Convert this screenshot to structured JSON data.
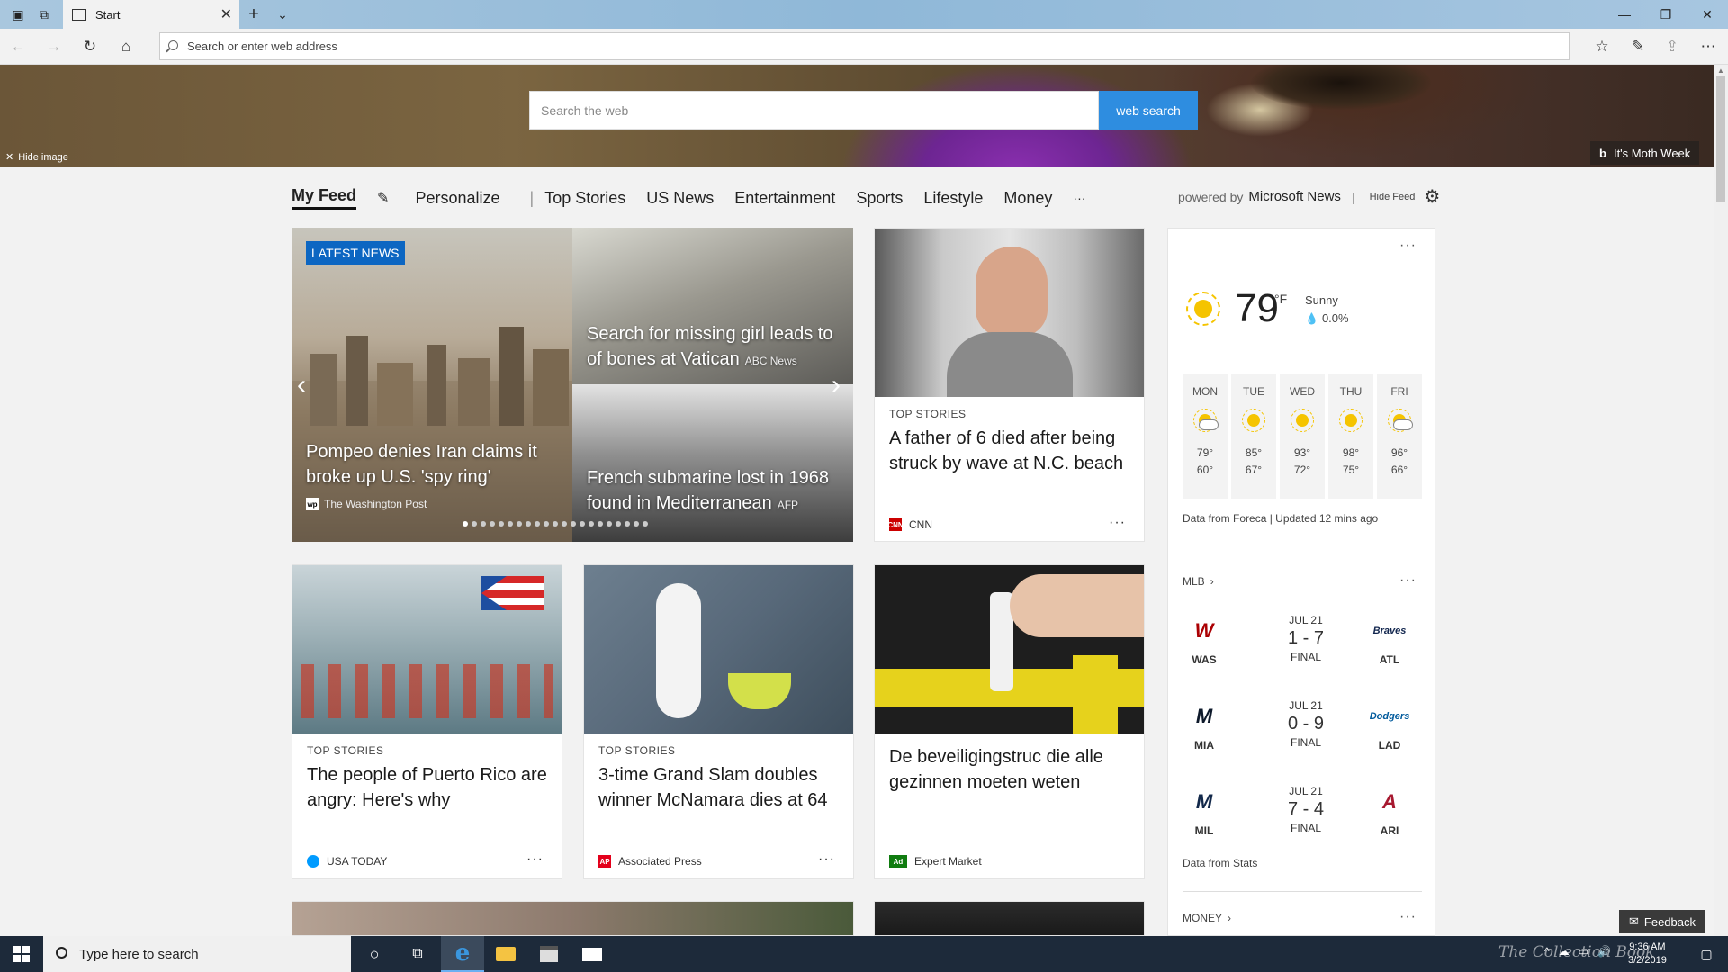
{
  "browser": {
    "tab_title": "Start",
    "address_placeholder": "Search or enter web address"
  },
  "hero": {
    "search_placeholder": "Search the web",
    "search_button": "web search",
    "hide_image": "Hide image",
    "image_caption": "It's Moth Week"
  },
  "feed_nav": {
    "items": [
      "My Feed",
      "Personalize",
      "Top Stories",
      "US News",
      "Entertainment",
      "Sports",
      "Lifestyle",
      "Money",
      "···"
    ],
    "powered_prefix": "powered by",
    "powered_brand": "Microsoft News",
    "hide_feed": "Hide Feed"
  },
  "carousel": {
    "badge": "LATEST NEWS",
    "main_title": "Pompeo denies Iran claims it broke up U.S. 'spy ring'",
    "main_source": "The Washington Post",
    "top_right_title": "Search for missing girl leads to of bones at Vatican",
    "top_right_source": "ABC News",
    "bottom_right_title": "French submarine lost in 1968 found in Mediterranean",
    "bottom_right_source": "AFP",
    "dot_count": 21,
    "active_dot": 0
  },
  "cards": [
    {
      "category": "TOP STORIES",
      "title": "A father of 6 died after being struck by wave at N.C. beach",
      "source": "CNN",
      "logo_text": "CNN",
      "logo_color": "#cc0000"
    },
    {
      "category": "TOP STORIES",
      "title": "The people of Puerto Rico are angry: Here's why",
      "source": "USA TODAY",
      "logo_text": "",
      "logo_color": "#009bff"
    },
    {
      "category": "TOP STORIES",
      "title": "3-time Grand Slam doubles winner McNamara dies at 64",
      "source": "Associated Press",
      "logo_text": "AP",
      "logo_color": "#e3001b"
    },
    {
      "category": "",
      "title": "De beveiligingstruc die alle gezinnen moeten weten",
      "source": "Expert Market",
      "logo_text": "Ad",
      "logo_color": "#107c10"
    }
  ],
  "weather": {
    "temp": "79",
    "unit": "°F",
    "condition": "Sunny",
    "precip": "0.0%",
    "forecast": [
      {
        "day": "MON",
        "hi": "79°",
        "lo": "60°",
        "icon": "partly-cloudy-icon"
      },
      {
        "day": "TUE",
        "hi": "85°",
        "lo": "67°",
        "icon": "sun-icon"
      },
      {
        "day": "WED",
        "hi": "93°",
        "lo": "72°",
        "icon": "sun-icon"
      },
      {
        "day": "THU",
        "hi": "98°",
        "lo": "75°",
        "icon": "sun-icon"
      },
      {
        "day": "FRI",
        "hi": "96°",
        "lo": "66°",
        "icon": "partly-cloudy-icon"
      }
    ],
    "footer": "Data from Foreca | Updated 12 mins ago"
  },
  "mlb": {
    "title": "MLB",
    "games": [
      {
        "date": "JUL 21",
        "score": "1 - 7",
        "status": "FINAL",
        "home": "WAS",
        "away": "ATL",
        "home_color": "#ab0003",
        "away_color": "#13274f",
        "home_mark": "W",
        "away_mark": "Braves"
      },
      {
        "date": "JUL 21",
        "score": "0 - 9",
        "status": "FINAL",
        "home": "MIA",
        "away": "LAD",
        "home_color": "#0e1a2b",
        "away_color": "#005a9c",
        "home_mark": "M",
        "away_mark": "Dodgers"
      },
      {
        "date": "JUL 21",
        "score": "7 - 4",
        "status": "FINAL",
        "home": "MIL",
        "away": "ARI",
        "home_color": "#13294b",
        "away_color": "#a71930",
        "home_mark": "M",
        "away_mark": "A"
      }
    ],
    "footer": "Data from Stats"
  },
  "money": {
    "title": "MONEY"
  },
  "feedback": "Feedback",
  "taskbar": {
    "search_placeholder": "Type here to search",
    "time": "9:36 AM",
    "date": "3/2/2019",
    "watermark": "The Collection Book"
  }
}
